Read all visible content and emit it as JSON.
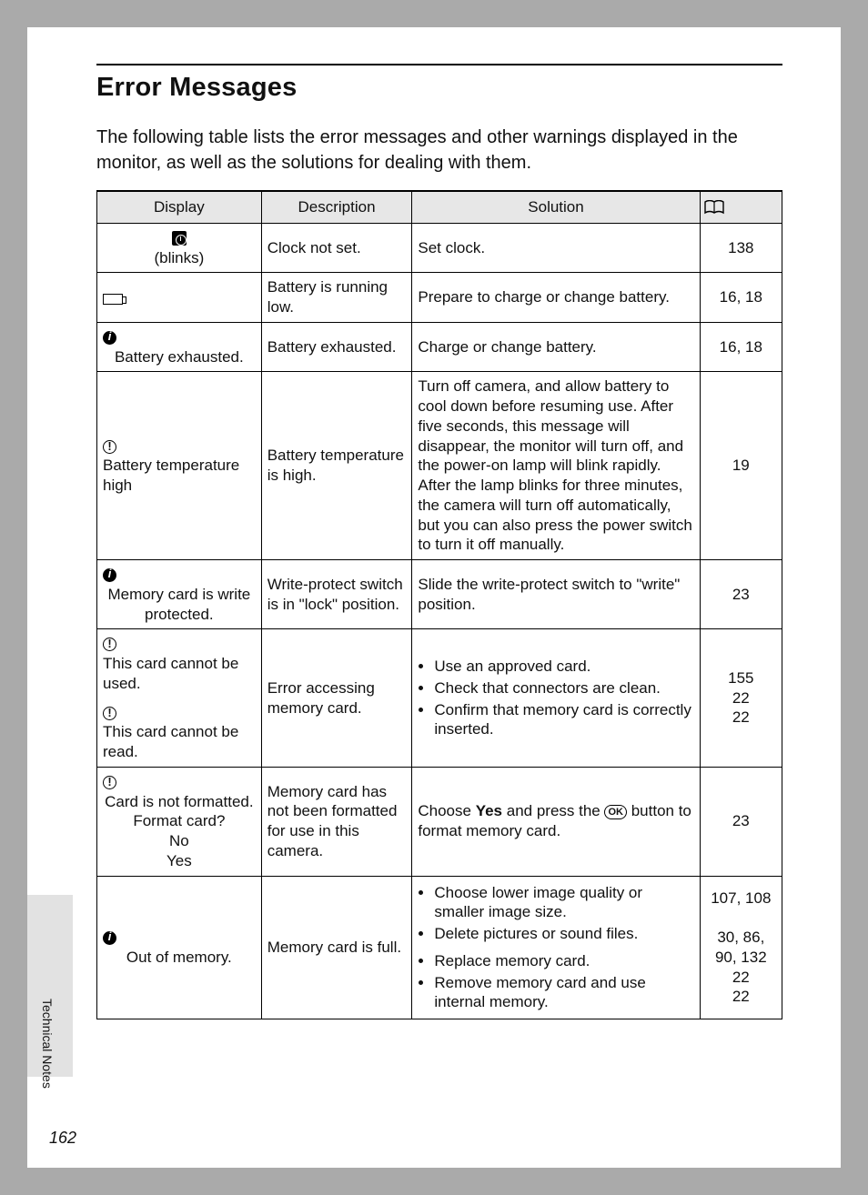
{
  "section_title": "Error Messages",
  "intro": "The following table lists the error messages and other warnings displayed in the monitor, as well as the solutions for dealing with them.",
  "headers": {
    "display": "Display",
    "description": "Description",
    "solution": "Solution"
  },
  "rows": {
    "r1": {
      "display_sub": "(blinks)",
      "description": "Clock not set.",
      "solution": "Set clock.",
      "ref": "138"
    },
    "r2": {
      "description": "Battery is running low.",
      "solution": "Prepare to charge or change battery.",
      "ref": "16, 18"
    },
    "r3": {
      "display_text": "Battery exhausted.",
      "description": "Battery exhausted.",
      "solution": "Charge or change battery.",
      "ref": "16, 18"
    },
    "r4": {
      "display_text": "Battery temperature high",
      "description": "Battery temperature is high.",
      "solution": "Turn off camera, and allow battery to cool down before resuming use. After five seconds, this message will disappear, the monitor will turn off, and the power-on lamp will blink rapidly. After the lamp blinks for three minutes, the camera will turn off automatically, but you can also press the power switch to turn it off manually.",
      "ref": "19"
    },
    "r5": {
      "display_text": "Memory card is write protected.",
      "description": "Write-protect switch is in \"lock\" position.",
      "solution": "Slide the write-protect switch to \"write\" position.",
      "ref": "23"
    },
    "r6a": {
      "display_text": "This card cannot be used."
    },
    "r6b": {
      "display_text": "This card cannot be read."
    },
    "r6_desc": "Error accessing memory card.",
    "r6_sol": {
      "i1": "Use an approved card.",
      "i2": "Check that connectors are clean.",
      "i3": "Confirm that memory card is correctly inserted."
    },
    "r6_ref": "155\n22\n22",
    "r7": {
      "display_l1": "Card is not formatted.",
      "display_l2": "Format card?",
      "display_l3": "No",
      "display_l4": "Yes",
      "description": "Memory card has not been formatted for use in this camera.",
      "sol_pre": "Choose ",
      "sol_bold": "Yes",
      "sol_mid": " and press the ",
      "ok_label": "OK",
      "sol_post": " button to format memory card.",
      "ref": "23"
    },
    "r8": {
      "display_text": "Out of memory.",
      "description": "Memory card is full.",
      "sol": {
        "i1": "Choose lower image quality or smaller image size.",
        "i2": "Delete pictures or sound files.",
        "i3": "Replace memory card.",
        "i4": "Remove memory card and use internal memory."
      },
      "ref": "107, 108\n\n30, 86, 90, 132\n22\n22"
    }
  },
  "side_label": "Technical Notes",
  "page_number": "162",
  "chart_data": {
    "type": "table",
    "title": "Error Messages",
    "columns": [
      "Display",
      "Description",
      "Solution",
      "Page reference"
    ],
    "rows": [
      [
        "(clock icon) (blinks)",
        "Clock not set.",
        "Set clock.",
        "138"
      ],
      [
        "(battery icon)",
        "Battery is running low.",
        "Prepare to charge or change battery.",
        "16, 18"
      ],
      [
        "(info icon) Battery exhausted.",
        "Battery exhausted.",
        "Charge or change battery.",
        "16, 18"
      ],
      [
        "(warn icon) Battery temperature high",
        "Battery temperature is high.",
        "Turn off camera, and allow battery to cool down before resuming use. After five seconds, this message will disappear, the monitor will turn off, and the power-on lamp will blink rapidly. After the lamp blinks for three minutes, the camera will turn off automatically, but you can also press the power switch to turn it off manually.",
        "19"
      ],
      [
        "(info icon) Memory card is write protected.",
        "Write-protect switch is in \"lock\" position.",
        "Slide the write-protect switch to \"write\" position.",
        "23"
      ],
      [
        "(warn icon) This card cannot be used. / (warn icon) This card cannot be read.",
        "Error accessing memory card.",
        "Use an approved card. / Check that connectors are clean. / Confirm that memory card is correctly inserted.",
        "155 / 22 / 22"
      ],
      [
        "(warn icon) Card is not formatted. Format card? No Yes",
        "Memory card has not been formatted for use in this camera.",
        "Choose Yes and press the OK button to format memory card.",
        "23"
      ],
      [
        "(info icon) Out of memory.",
        "Memory card is full.",
        "Choose lower image quality or smaller image size. / Delete pictures or sound files. / Replace memory card. / Remove memory card and use internal memory.",
        "107, 108 / 30, 86, 90, 132 / 22 / 22"
      ]
    ]
  }
}
